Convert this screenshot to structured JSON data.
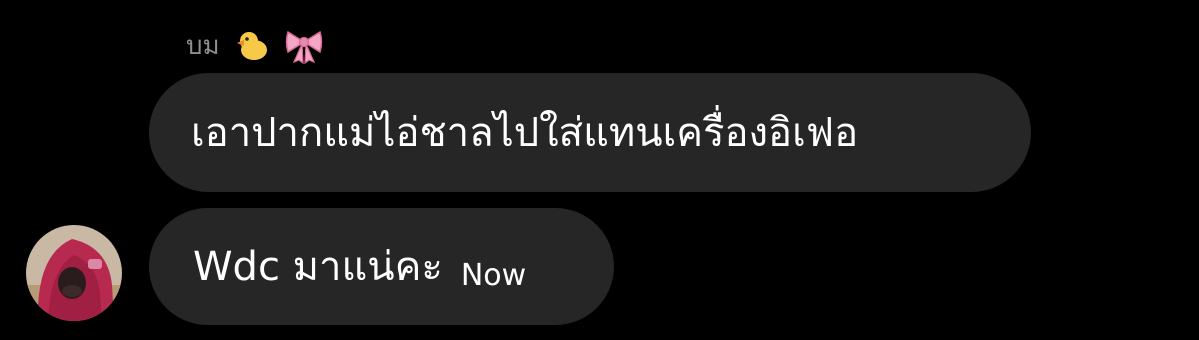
{
  "sender": {
    "name": "บม",
    "emojis": [
      "duck-icon",
      "bow-icon"
    ]
  },
  "messages": [
    {
      "text": "เอาปากแม่ไอ่ชาลไปใส่แทนเครื่องอิเฟอ"
    },
    {
      "text": "Wdc มาแน่คะ",
      "time": "Now"
    }
  ],
  "colors": {
    "background": "#000000",
    "bubble": "#262626",
    "sender_name": "#8e8e93",
    "text": "#ffffff"
  }
}
